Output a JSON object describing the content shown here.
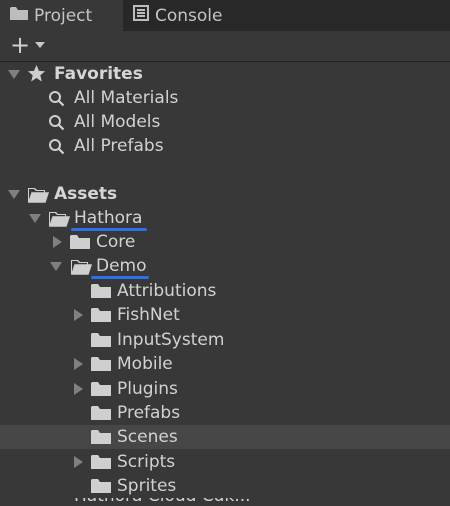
{
  "tabs": {
    "project": "Project",
    "console": "Console"
  },
  "toolbar": {
    "add_symbol": "+"
  },
  "tree": {
    "favorites": "Favorites",
    "all_materials": "All Materials",
    "all_models": "All Models",
    "all_prefabs": "All Prefabs",
    "assets": "Assets",
    "hathora": "Hathora",
    "core": "Core",
    "demo": "Demo",
    "attributions": "Attributions",
    "fishnet": "FishNet",
    "inputsystem": "InputSystem",
    "mobile": "Mobile",
    "plugins": "Plugins",
    "prefabs": "Prefabs",
    "scenes": "Scenes",
    "scripts": "Scripts",
    "sprites": "Sprites",
    "partial_next": "Hathora Cloud Cdk..."
  },
  "colors": {
    "underline": "#2e6ff0",
    "selected_row": "#474747"
  },
  "icons": [
    "folder-icon",
    "console-icon",
    "star-icon",
    "search-icon",
    "open-folder-icon"
  ]
}
